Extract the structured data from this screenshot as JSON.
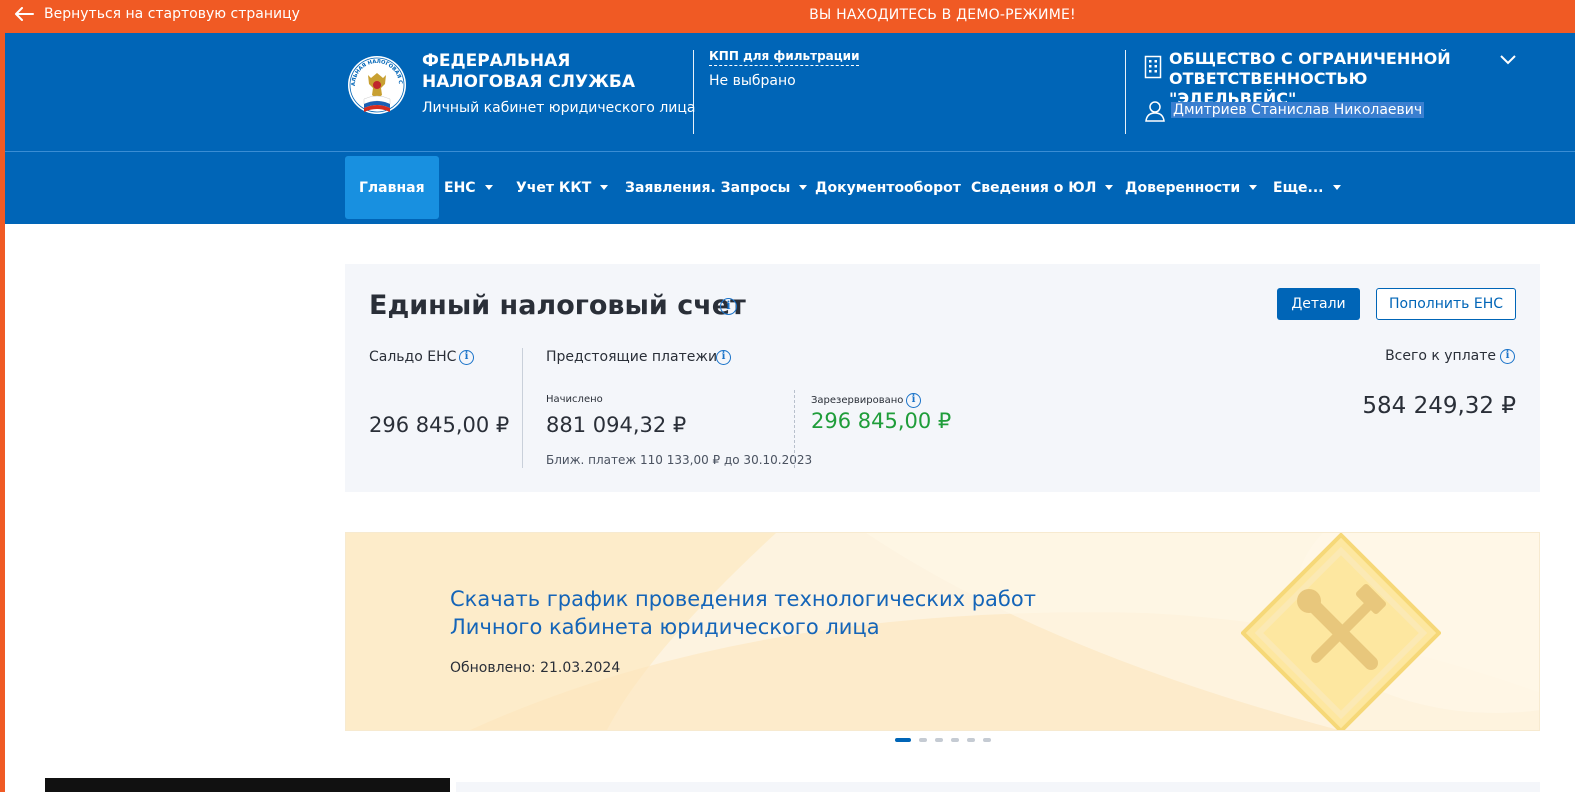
{
  "demo_bar": {
    "back_label": "Вернуться на стартовую страницу",
    "message": "ВЫ НАХОДИТЕСЬ В ДЕМО-РЕЖИМЕ!"
  },
  "header": {
    "org_title_line1": "ФЕДЕРАЛЬНАЯ",
    "org_title_line2": "НАЛОГОВАЯ СЛУЖБА",
    "org_subtitle": "Личный кабинет юридического лица",
    "kpp_label": "КПП для фильтрации",
    "kpp_value": "Не выбрано",
    "company_name": "ОБЩЕСТВО С ОГРАНИЧЕННОЙ ОТВЕТСТВЕННОСТЬЮ \"ЭДЕЛЬВЕЙС\"",
    "user_name": "Дмитриев Станислав Николаевич",
    "logo_text": "ФЕДЕРАЛЬНАЯ НАЛОГОВАЯ СЛУЖБА"
  },
  "nav": {
    "items": [
      {
        "label": "Главная",
        "active": true,
        "dropdown": false
      },
      {
        "label": "ЕНС",
        "dropdown": true
      },
      {
        "label": "Учет ККТ",
        "dropdown": true
      },
      {
        "label": "Заявления. Запросы",
        "dropdown": true
      },
      {
        "label": "Документооборот",
        "dropdown": false
      },
      {
        "label": "Сведения о ЮЛ",
        "dropdown": true
      },
      {
        "label": "Доверенности",
        "dropdown": true
      },
      {
        "label": "Еще...",
        "dropdown": true
      }
    ]
  },
  "ens": {
    "title": "Единый налоговый счет",
    "details_button": "Детали",
    "topup_button": "Пополнить ЕНС",
    "saldo_label": "Сальдо ЕНС",
    "saldo_value": "296 845,00 ₽",
    "upcoming_label": "Предстоящие платежи",
    "accrued_label": "Начислено",
    "accrued_value": "881 094,32 ₽",
    "nearest_payment": "Ближ. платеж 110 133,00 ₽ до 30.10.2023",
    "reserved_label": "Зарезервировано",
    "reserved_value": "296 845,00 ₽",
    "total_label": "Всего к уплате",
    "total_value": "584 249,32 ₽",
    "reserved_color": "#1f9d3a"
  },
  "banner": {
    "title_line1": "Скачать график проведения технологических работ",
    "title_line2": "Личного кабинета юридического лица",
    "updated": "Обновлено: 21.03.2024",
    "icon": "tools-warning-sign-icon"
  },
  "carousel": {
    "count": 6,
    "active_index": 0
  },
  "colors": {
    "brand_blue": "#0065b7",
    "demo_orange": "#f05a24",
    "nav_active": "#1890e0"
  }
}
